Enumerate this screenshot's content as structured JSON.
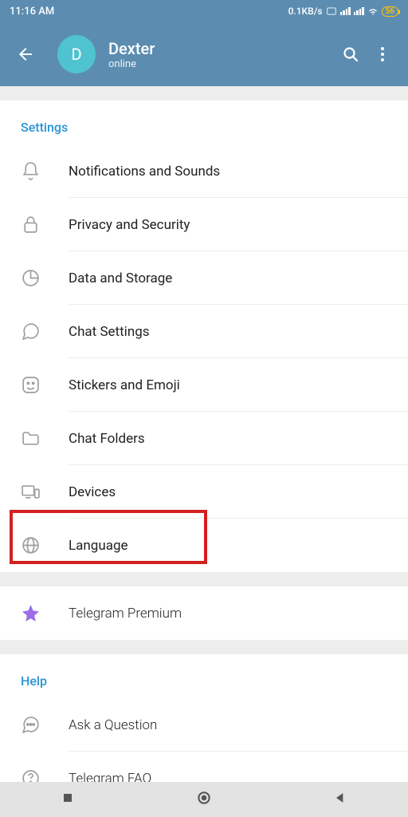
{
  "status": {
    "time": "11:16 AM",
    "speed": "0.1KB/s",
    "battery": "56"
  },
  "header": {
    "name": "Dexter",
    "status": "online",
    "avatar_letter": "D"
  },
  "sections": {
    "settings": {
      "title": "Settings",
      "items": [
        "Notifications and Sounds",
        "Privacy and Security",
        "Data and Storage",
        "Chat Settings",
        "Stickers and Emoji",
        "Chat Folders",
        "Devices",
        "Language"
      ]
    },
    "premium": {
      "label": "Telegram Premium"
    },
    "help": {
      "title": "Help",
      "items": [
        "Ask a Question",
        "Telegram FAQ"
      ]
    }
  }
}
